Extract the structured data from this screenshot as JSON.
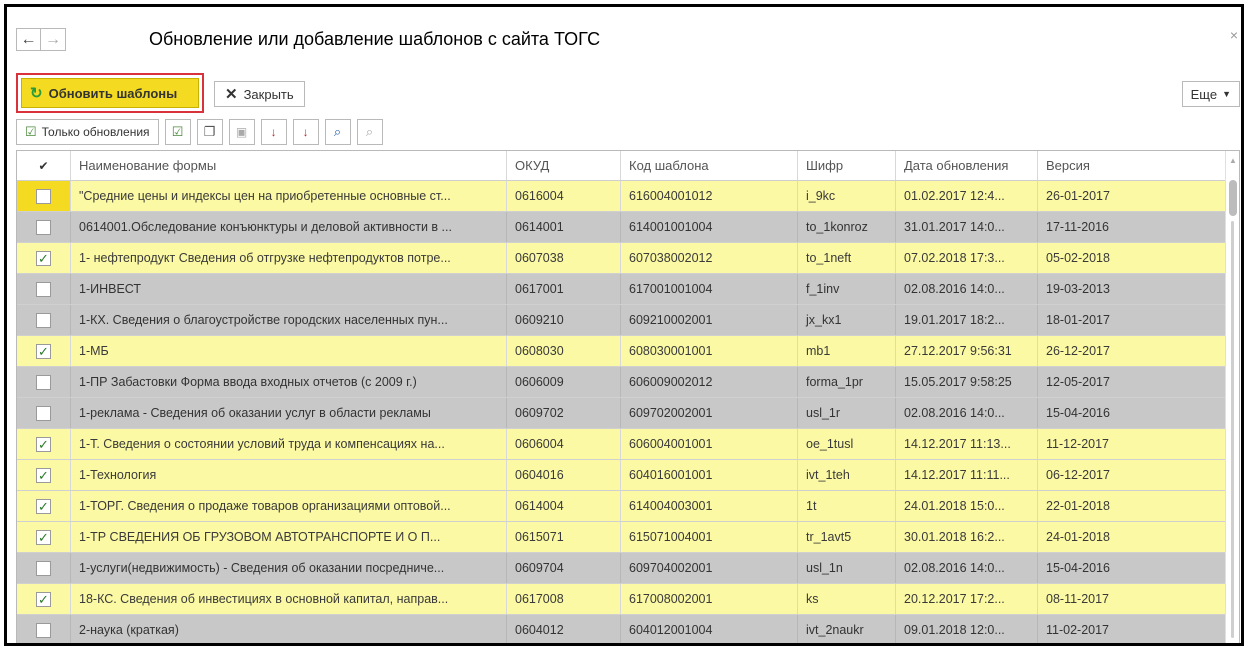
{
  "window": {
    "title": "Обновление или добавление шаблонов с сайта ТОГС",
    "back_glyph": "←",
    "forward_glyph": "→",
    "close_glyph": "×"
  },
  "commands": {
    "refresh_label": "Обновить шаблоны",
    "refresh_icon": "refresh-icon",
    "close_label": "Закрыть",
    "close_icon": "x-icon",
    "more_label": "Еще"
  },
  "toolbar": {
    "updates_only_label": "Только обновления",
    "buttons": [
      "check-all-icon",
      "uncheck-all-icon",
      "filter-icon",
      "sort-asc-icon",
      "sort-desc-icon",
      "find-icon",
      "cancel-find-icon"
    ]
  },
  "colors": {
    "accent_yellow": "#f4db21",
    "row_yellow": "#fbf9a4",
    "row_gray": "#c8c8c8",
    "highlight_border": "#d9323a"
  },
  "table": {
    "columns": [
      "Наименование формы",
      "ОКУД",
      "Код шаблона",
      "Шифр",
      "Дата обновления",
      "Версия"
    ],
    "rows": [
      {
        "checked": false,
        "style": "yellow",
        "name": "\"Средние цены и индексы цен на приобретенные основные ст...",
        "okud": "0616004",
        "code": "616004001012",
        "cipher": "i_9kc",
        "date": "01.02.2017 12:4...",
        "version": "26-01-2017"
      },
      {
        "checked": false,
        "style": "gray",
        "name": "0614001.Обследование конъюнктуры и деловой активности в ...",
        "okud": "0614001",
        "code": "614001001004",
        "cipher": "to_1konroz",
        "date": "31.01.2017 14:0...",
        "version": "17-11-2016"
      },
      {
        "checked": true,
        "style": "yellow",
        "name": "1- нефтепродукт Сведения об отгрузке нефтепродуктов потре...",
        "okud": "0607038",
        "code": "607038002012",
        "cipher": "to_1neft",
        "date": "07.02.2018 17:3...",
        "version": "05-02-2018"
      },
      {
        "checked": false,
        "style": "gray",
        "name": "1-ИНВЕСТ",
        "okud": "0617001",
        "code": "617001001004",
        "cipher": "f_1inv",
        "date": "02.08.2016 14:0...",
        "version": "19-03-2013"
      },
      {
        "checked": false,
        "style": "gray",
        "name": "1-КХ. Сведения о благоустройстве городских населенных пун...",
        "okud": "0609210",
        "code": "609210002001",
        "cipher": "jx_kx1",
        "date": "19.01.2017 18:2...",
        "version": "18-01-2017"
      },
      {
        "checked": true,
        "style": "yellow",
        "name": "1-МБ",
        "okud": "0608030",
        "code": "608030001001",
        "cipher": "mb1",
        "date": "27.12.2017 9:56:31",
        "version": "26-12-2017"
      },
      {
        "checked": false,
        "style": "gray",
        "name": "1-ПР Забастовки Форма ввода входных отчетов (с 2009 г.)",
        "okud": "0606009",
        "code": "606009002012",
        "cipher": "forma_1pr",
        "date": "15.05.2017 9:58:25",
        "version": "12-05-2017"
      },
      {
        "checked": false,
        "style": "gray",
        "name": "1-реклама - Сведения об оказании услуг в области рекламы",
        "okud": "0609702",
        "code": "609702002001",
        "cipher": "usl_1r",
        "date": "02.08.2016 14:0...",
        "version": "15-04-2016"
      },
      {
        "checked": true,
        "style": "yellow",
        "name": "1-Т.  Сведения о состоянии условий труда и компенсациях на...",
        "okud": "0606004",
        "code": "606004001001",
        "cipher": "oe_1tusl",
        "date": "14.12.2017 11:13...",
        "version": "11-12-2017"
      },
      {
        "checked": true,
        "style": "yellow",
        "name": "1-Технология",
        "okud": "0604016",
        "code": "604016001001",
        "cipher": "ivt_1teh",
        "date": "14.12.2017 11:11...",
        "version": "06-12-2017"
      },
      {
        "checked": true,
        "style": "yellow",
        "name": "1-ТОРГ. Сведения о продаже товаров организациями оптовой...",
        "okud": "0614004",
        "code": "614004003001",
        "cipher": "1t",
        "date": "24.01.2018 15:0...",
        "version": "22-01-2018"
      },
      {
        "checked": true,
        "style": "yellow",
        "name": "1-ТР СВЕДЕНИЯ ОБ  ГРУЗОВОМ АВТОТРАНСПОРТЕ И О П...",
        "okud": "0615071",
        "code": "615071004001",
        "cipher": "tr_1avt5",
        "date": "30.01.2018 16:2...",
        "version": "24-01-2018"
      },
      {
        "checked": false,
        "style": "gray",
        "name": "1-услуги(недвижимость) - Сведения об оказании посредниче...",
        "okud": "0609704",
        "code": "609704002001",
        "cipher": "usl_1n",
        "date": "02.08.2016 14:0...",
        "version": "15-04-2016"
      },
      {
        "checked": true,
        "style": "yellow",
        "name": "18-КС. Сведения об инвестициях в основной капитал, направ...",
        "okud": "0617008",
        "code": "617008002001",
        "cipher": "ks",
        "date": "20.12.2017 17:2...",
        "version": "08-11-2017"
      },
      {
        "checked": false,
        "style": "gray",
        "name": "2-наука (краткая)",
        "okud": "0604012",
        "code": "604012001004",
        "cipher": "ivt_2naukr",
        "date": "09.01.2018 12:0...",
        "version": "11-02-2017"
      }
    ]
  }
}
